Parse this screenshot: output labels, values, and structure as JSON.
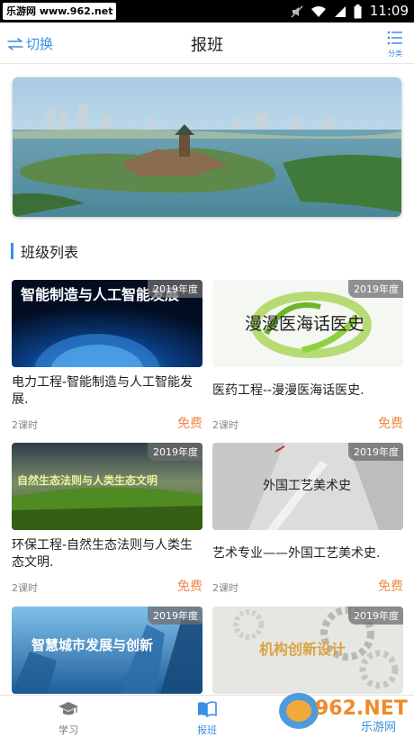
{
  "status_bar": {
    "watermark": "乐游网 www.962.net",
    "time": "11:09"
  },
  "nav": {
    "switch_label": "切换",
    "title": "报班",
    "category_label": "分类"
  },
  "section": {
    "title": "班级列表"
  },
  "courses": [
    {
      "thumb_text": "智能制造与人工智能发展",
      "year": "2019年度",
      "title": "电力工程-智能制造与人工智能发展.",
      "lessons": "2课时",
      "price": "免费"
    },
    {
      "thumb_text": "漫漫医海话医史",
      "year": "2019年度",
      "title": "医药工程--漫漫医海话医史.",
      "lessons": "2课时",
      "price": "免费"
    },
    {
      "thumb_text": "自然生态法则与人类生态文明",
      "year": "2019年度",
      "title": "环保工程-自然生态法则与人类生态文明.",
      "lessons": "2课时",
      "price": "免费"
    },
    {
      "thumb_text": "外国工艺美术史",
      "year": "2019年度",
      "title": "艺术专业——外国工艺美术史.",
      "lessons": "2课时",
      "price": "免费"
    },
    {
      "thumb_text": "智慧城市发展与创新",
      "year": "2019年度"
    },
    {
      "thumb_text": "机构创新设计",
      "year": "2019年度"
    }
  ],
  "tabs": [
    {
      "label": "学习"
    },
    {
      "label": "报班"
    }
  ],
  "brand": {
    "logo_text": "962.NET",
    "sub_text": "乐游网"
  },
  "colors": {
    "accent": "#3a8ee6",
    "price": "#f08a4b"
  }
}
